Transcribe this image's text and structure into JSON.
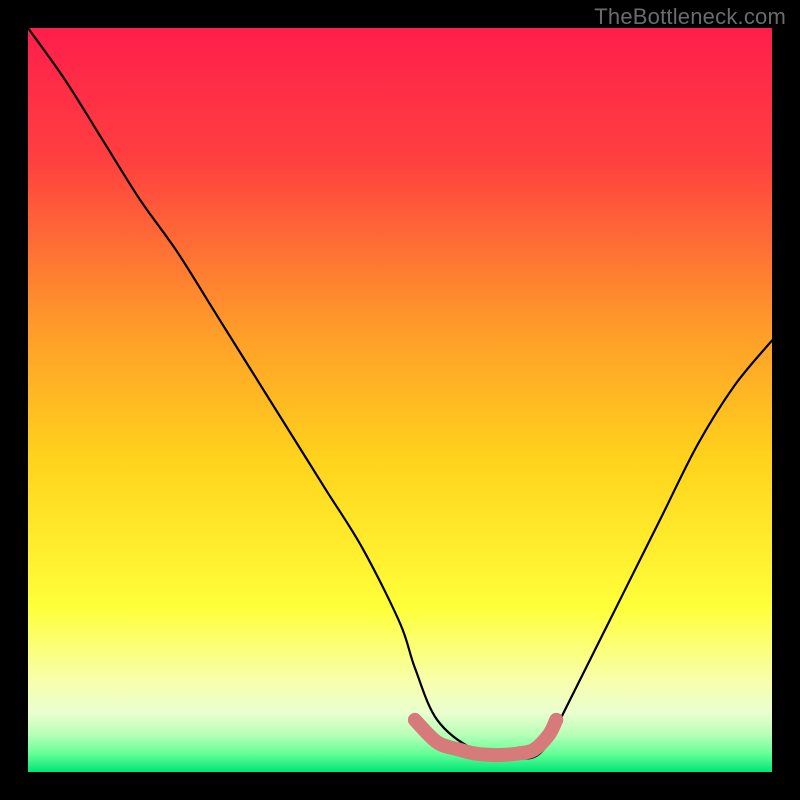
{
  "watermark": "TheBottleneck.com",
  "chart_data": {
    "type": "line",
    "title": "",
    "xlabel": "",
    "ylabel": "",
    "xlim": [
      0,
      100
    ],
    "ylim": [
      0,
      100
    ],
    "background_gradient_stops": [
      {
        "pos": 0.0,
        "color": "#ff1e4b"
      },
      {
        "pos": 0.18,
        "color": "#ff4040"
      },
      {
        "pos": 0.4,
        "color": "#ff9a2a"
      },
      {
        "pos": 0.58,
        "color": "#ffd31c"
      },
      {
        "pos": 0.78,
        "color": "#ffff3a"
      },
      {
        "pos": 0.88,
        "color": "#f7ffae"
      },
      {
        "pos": 0.92,
        "color": "#eaffcf"
      },
      {
        "pos": 0.95,
        "color": "#b7ffb7"
      },
      {
        "pos": 0.975,
        "color": "#66ff99"
      },
      {
        "pos": 1.0,
        "color": "#00e676"
      }
    ],
    "series": [
      {
        "name": "bottleneck-curve",
        "color": "#000000",
        "x": [
          0,
          5,
          10,
          15,
          20,
          25,
          30,
          35,
          40,
          45,
          50,
          52,
          55,
          60,
          65,
          68,
          70,
          72,
          75,
          80,
          85,
          90,
          95,
          100
        ],
        "y": [
          100,
          93,
          85,
          77,
          70,
          62,
          54,
          46,
          38,
          30,
          20,
          14,
          7,
          3,
          2,
          2,
          4,
          8,
          14,
          24,
          34,
          44,
          52,
          58
        ]
      }
    ],
    "highlight_band": {
      "name": "optimal-range-marker",
      "color": "#d77a7a",
      "x": [
        52,
        55,
        58,
        60,
        62,
        64,
        66,
        68,
        70,
        71
      ],
      "y": [
        7,
        4,
        3,
        2.5,
        2.3,
        2.3,
        2.5,
        3,
        5,
        7
      ]
    }
  }
}
